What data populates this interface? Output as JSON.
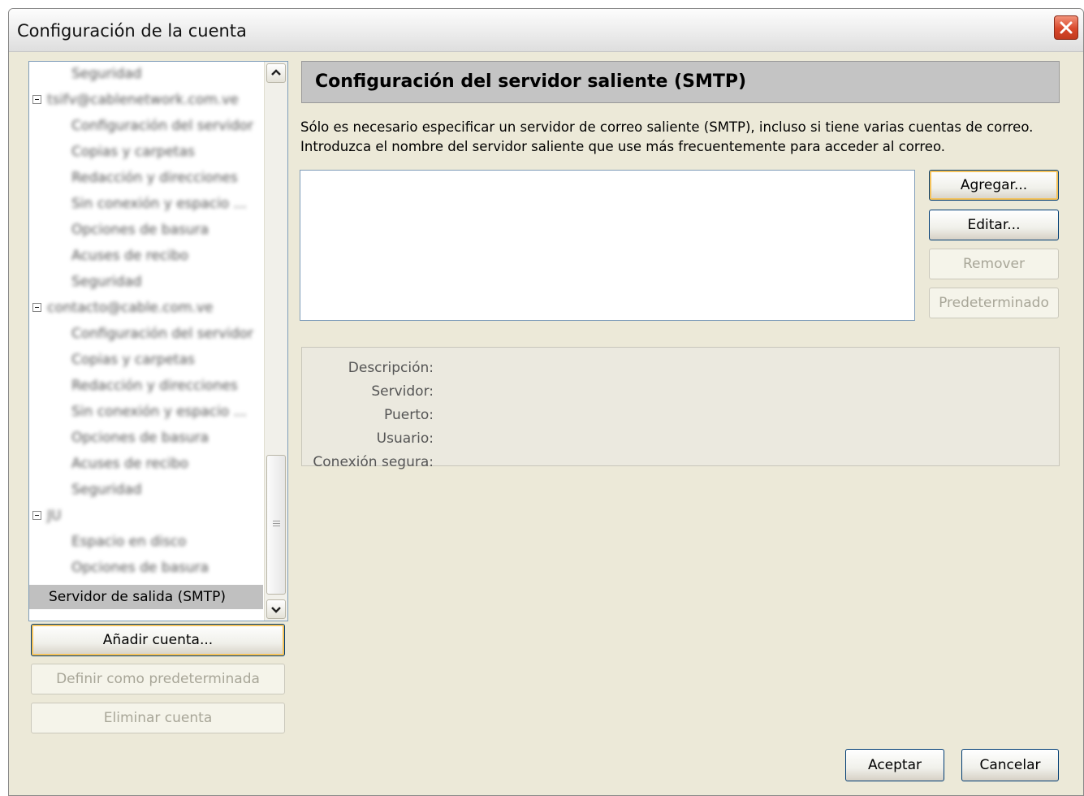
{
  "window": {
    "title": "Configuración de la cuenta"
  },
  "tree": {
    "items": [
      {
        "label": "Seguridad",
        "depth": 2,
        "blurred": true
      },
      {
        "label": "tsifv@cablenetwork.com.ve",
        "depth": 0,
        "blurred": true,
        "expanded": true
      },
      {
        "label": "Configuración del servidor",
        "depth": 1,
        "blurred": true
      },
      {
        "label": "Copias y carpetas",
        "depth": 1,
        "blurred": true
      },
      {
        "label": "Redacción y direcciones",
        "depth": 1,
        "blurred": true
      },
      {
        "label": "Sin conexión y espacio ...",
        "depth": 1,
        "blurred": true
      },
      {
        "label": "Opciones de basura",
        "depth": 1,
        "blurred": true
      },
      {
        "label": "Acuses de recibo",
        "depth": 1,
        "blurred": true
      },
      {
        "label": "Seguridad",
        "depth": 1,
        "blurred": true
      },
      {
        "label": "contacto@cable.com.ve",
        "depth": 0,
        "blurred": true,
        "expanded": true
      },
      {
        "label": "Configuración del servidor",
        "depth": 1,
        "blurred": true
      },
      {
        "label": "Copias y carpetas",
        "depth": 1,
        "blurred": true
      },
      {
        "label": "Redacción y direcciones",
        "depth": 1,
        "blurred": true
      },
      {
        "label": "Sin conexión y espacio ...",
        "depth": 1,
        "blurred": true
      },
      {
        "label": "Opciones de basura",
        "depth": 1,
        "blurred": true
      },
      {
        "label": "Acuses de recibo",
        "depth": 1,
        "blurred": true
      },
      {
        "label": "Seguridad",
        "depth": 1,
        "blurred": true
      },
      {
        "label": "JU",
        "depth": 0,
        "blurred": true,
        "expanded": true
      },
      {
        "label": "Espacio en disco",
        "depth": 1,
        "blurred": true
      },
      {
        "label": "Opciones de basura",
        "depth": 1,
        "blurred": true
      },
      {
        "label": "Servidor de salida (SMTP)",
        "depth": 0,
        "blurred": false,
        "selected": true
      }
    ]
  },
  "left_buttons": {
    "add_account": "Añadir cuenta...",
    "set_default": "Definir como predeterminada",
    "remove_account": "Eliminar cuenta"
  },
  "panel": {
    "header": "Configuración del servidor saliente (SMTP)",
    "description_line1": "Sólo es necesario especificar un servidor de correo saliente (SMTP), incluso si tiene varias cuentas de correo.",
    "description_line2": "Introduzca el nombre del servidor saliente que use más frecuentemente para acceder al correo.",
    "buttons": {
      "add": "Agregar...",
      "edit": "Editar...",
      "remove": "Remover",
      "default": "Predeterminado"
    },
    "details": {
      "description": "Descripción:",
      "server": "Servidor:",
      "port": "Puerto:",
      "user": "Usuario:",
      "secure": "Conexión segura:"
    }
  },
  "footer": {
    "ok": "Aceptar",
    "cancel": "Cancelar"
  }
}
